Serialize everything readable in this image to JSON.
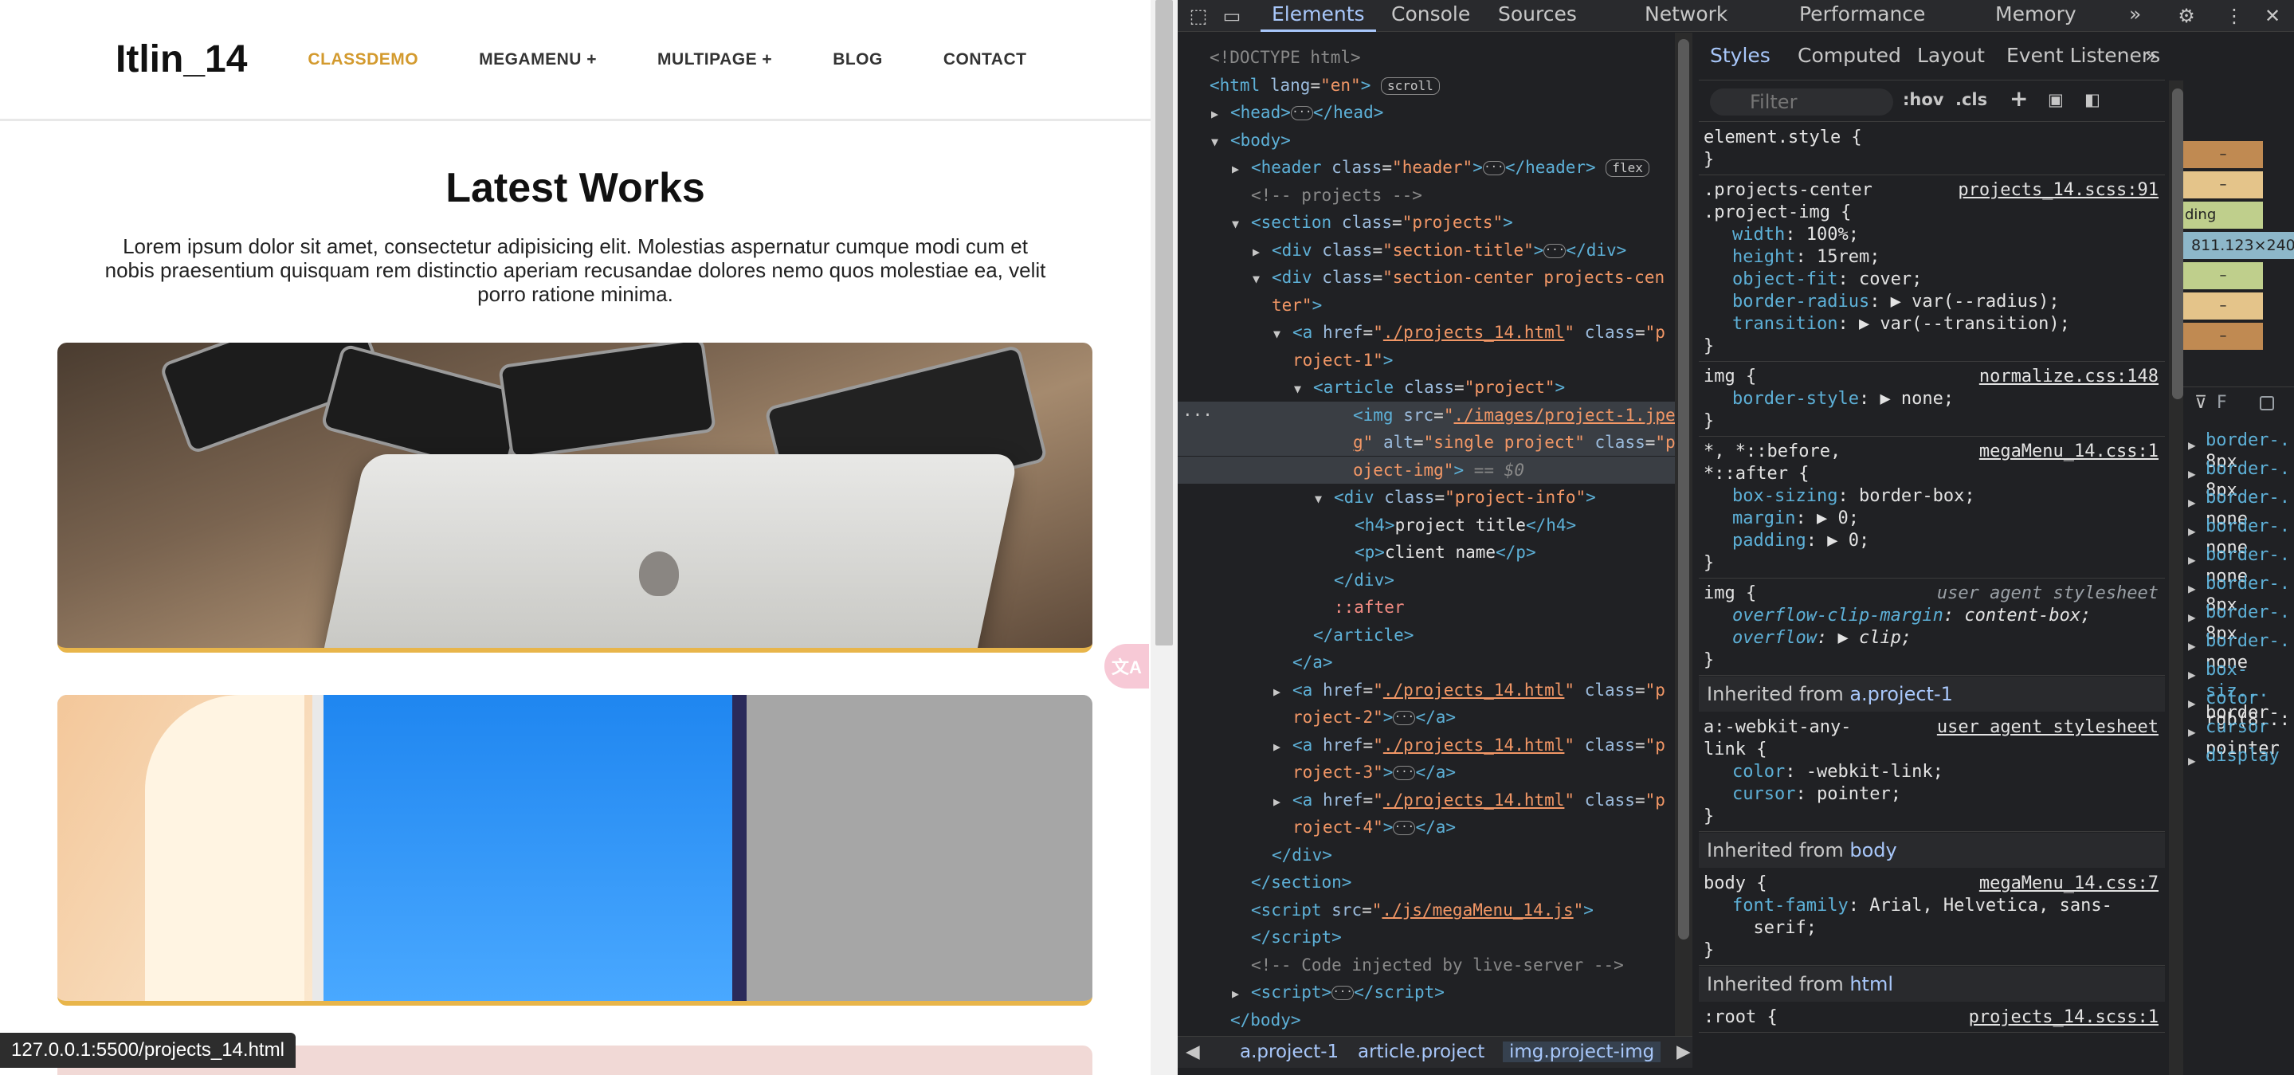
{
  "page": {
    "logo": "Itlin_14",
    "nav": [
      {
        "label": "CLASSDEMO",
        "active": true
      },
      {
        "label": "MEGAMENU +"
      },
      {
        "label": "MULTIPAGE +"
      },
      {
        "label": "BLOG"
      },
      {
        "label": "CONTACT"
      }
    ],
    "section_title": "Latest Works",
    "section_desc": "Lorem ipsum dolor sit amet, consectetur adipisicing elit. Molestias aspernatur cumque modi cum et nobis praesentium quisquam rem distinctio aperiam recusandae dolores nemo quos molestiae ea, velit porro ratione minima.",
    "status_url": "127.0.0.1:5500/projects_14.html",
    "accent": "#d39a2e",
    "card_border": "#e8b54a"
  },
  "devtools": {
    "tabs": [
      "Elements",
      "Console",
      "Sources",
      "Network",
      "Performance",
      "Memory"
    ],
    "more_tabs": "»",
    "dom": [
      {
        "indent": 0,
        "tri": "",
        "html": "<span class='cmt'>&lt;!DOCTYPE html&gt;</span>"
      },
      {
        "indent": 0,
        "tri": "",
        "html": "<span class='tag'>&lt;html</span> <span class='attr'>lang</span>=<span class='val'>\"en\"</span><span class='tag'>&gt;</span> <span class='badge'>scroll</span>"
      },
      {
        "indent": 1,
        "tri": "▶",
        "html": "<span class='tag'>&lt;head&gt;</span><span class='ellip'>···</span><span class='tag'>&lt;/head&gt;</span>"
      },
      {
        "indent": 1,
        "tri": "▼",
        "html": "<span class='tag'>&lt;body&gt;</span>"
      },
      {
        "indent": 2,
        "tri": "▶",
        "html": "<span class='tag'>&lt;header</span> <span class='attr'>class</span>=<span class='val'>\"header\"</span><span class='tag'>&gt;</span><span class='ellip'>···</span><span class='tag'>&lt;/header&gt;</span> <span class='badge'>flex</span>"
      },
      {
        "indent": 2,
        "tri": "",
        "html": "<span class='cmt'>&lt;!-- projects --&gt;</span>"
      },
      {
        "indent": 2,
        "tri": "▼",
        "html": "<span class='tag'>&lt;section</span> <span class='attr'>class</span>=<span class='val'>\"projects\"</span><span class='tag'>&gt;</span>"
      },
      {
        "indent": 3,
        "tri": "▶",
        "html": "<span class='tag'>&lt;div</span> <span class='attr'>class</span>=<span class='val'>\"section-title\"</span><span class='tag'>&gt;</span><span class='ellip'>···</span><span class='tag'>&lt;/div&gt;</span>"
      },
      {
        "indent": 3,
        "tri": "▼",
        "html": "<span class='tag'>&lt;div</span> <span class='attr'>class</span>=<span class='val'>\"section-center projects-cen</span>"
      },
      {
        "indent": 3,
        "tri": "",
        "html": "<span class='val'>ter\"</span><span class='tag'>&gt;</span>"
      },
      {
        "indent": 4,
        "tri": "▼",
        "html": "<span class='tag'>&lt;a</span> <span class='attr'>href</span>=<span class='val'>\"<span class='link'>./projects_14.html</span>\"</span> <span class='attr'>class</span>=<span class='val'>\"p</span>"
      },
      {
        "indent": 4,
        "tri": "",
        "html": "<span class='val'>roject-1\"</span><span class='tag'>&gt;</span>"
      },
      {
        "indent": 5,
        "tri": "▼",
        "html": "<span class='tag'>&lt;article</span> <span class='attr'>class</span>=<span class='val'>\"project\"</span><span class='tag'>&gt;</span>"
      },
      {
        "indent": 6,
        "tri": "",
        "selected": true,
        "html": "<span class='tag'>&lt;img</span> <span class='attr'>src</span>=<span class='val'>\"<span class='link'>./images/project-1.jpe</span></span>"
      },
      {
        "indent": 6,
        "tri": "",
        "selected": true,
        "html": "<span class='link val'>g</span><span class='val'>\"</span> <span class='attr'>alt</span>=<span class='val'>\"single project\"</span> <span class='attr'>class</span>=<span class='val'>\"pr</span>"
      },
      {
        "indent": 6,
        "tri": "",
        "selected": true,
        "html": "<span class='val'>oject-img\"</span><span class='tag'>&gt;</span> <span class='cmt'>== <i>$0</i></span>"
      },
      {
        "indent": 6,
        "tri": "▼",
        "html": "<span class='tag'>&lt;div</span> <span class='attr'>class</span>=<span class='val'>\"project-info\"</span><span class='tag'>&gt;</span>"
      },
      {
        "indent": 7,
        "tri": "",
        "html": "<span class='tag'>&lt;h4&gt;</span><span class='txt'>project title</span><span class='tag'>&lt;/h4&gt;</span>"
      },
      {
        "indent": 7,
        "tri": "",
        "html": "<span class='tag'>&lt;p&gt;</span><span class='txt'>client name</span><span class='tag'>&lt;/p&gt;</span>"
      },
      {
        "indent": 6,
        "tri": "",
        "html": "<span class='tag'>&lt;/div&gt;</span>"
      },
      {
        "indent": 6,
        "tri": "",
        "html": "<span class='pseudo'>::after</span>"
      },
      {
        "indent": 5,
        "tri": "",
        "html": "<span class='tag'>&lt;/article&gt;</span>"
      },
      {
        "indent": 4,
        "tri": "",
        "html": "<span class='tag'>&lt;/a&gt;</span>"
      },
      {
        "indent": 4,
        "tri": "▶",
        "html": "<span class='tag'>&lt;a</span> <span class='attr'>href</span>=<span class='val'>\"<span class='link'>./projects_14.html</span>\"</span> <span class='attr'>class</span>=<span class='val'>\"p</span>"
      },
      {
        "indent": 4,
        "tri": "",
        "html": "<span class='val'>roject-2\"</span><span class='tag'>&gt;</span><span class='ellip'>···</span><span class='tag'>&lt;/a&gt;</span>"
      },
      {
        "indent": 4,
        "tri": "▶",
        "html": "<span class='tag'>&lt;a</span> <span class='attr'>href</span>=<span class='val'>\"<span class='link'>./projects_14.html</span>\"</span> <span class='attr'>class</span>=<span class='val'>\"p</span>"
      },
      {
        "indent": 4,
        "tri": "",
        "html": "<span class='val'>roject-3\"</span><span class='tag'>&gt;</span><span class='ellip'>···</span><span class='tag'>&lt;/a&gt;</span>"
      },
      {
        "indent": 4,
        "tri": "▶",
        "html": "<span class='tag'>&lt;a</span> <span class='attr'>href</span>=<span class='val'>\"<span class='link'>./projects_14.html</span>\"</span> <span class='attr'>class</span>=<span class='val'>\"p</span>"
      },
      {
        "indent": 4,
        "tri": "",
        "html": "<span class='val'>roject-4\"</span><span class='tag'>&gt;</span><span class='ellip'>···</span><span class='tag'>&lt;/a&gt;</span>"
      },
      {
        "indent": 3,
        "tri": "",
        "html": "<span class='tag'>&lt;/div&gt;</span>"
      },
      {
        "indent": 2,
        "tri": "",
        "html": "<span class='tag'>&lt;/section&gt;</span>"
      },
      {
        "indent": 2,
        "tri": "",
        "html": "<span class='tag'>&lt;script</span> <span class='attr'>src</span>=<span class='val'>\"<span class='link'>./js/megaMenu_14.js</span>\"</span><span class='tag'>&gt;</span>"
      },
      {
        "indent": 2,
        "tri": "",
        "html": "<span class='tag'>&lt;/script&gt;</span>"
      },
      {
        "indent": 2,
        "tri": "",
        "html": "<span class='cmt'>&lt;!-- Code injected by live-server --&gt;</span>"
      },
      {
        "indent": 2,
        "tri": "▶",
        "html": "<span class='tag'>&lt;script&gt;</span><span class='ellip'>···</span><span class='tag'>&lt;/script&gt;</span>"
      },
      {
        "indent": 1,
        "tri": "",
        "html": "<span class='tag'>&lt;/body&gt;</span>"
      }
    ],
    "breadcrumbs": [
      "a.project-1",
      "article.project",
      "img.project-img"
    ],
    "styles_tabs": [
      "Styles",
      "Computed",
      "Layout",
      "Event Listeners"
    ],
    "styles_more": "»",
    "filter_placeholder": "Filter",
    "filter_hov": ":hov",
    "filter_cls": ".cls",
    "rules": [
      {
        "selector": "element.style {",
        "source": "",
        "props": [],
        "close": "}"
      },
      {
        "selector": ".projects-center\n.project-img {",
        "source": "projects_14.scss:91",
        "props": [
          [
            "width",
            "100%;"
          ],
          [
            "height",
            "15rem;"
          ],
          [
            "object-fit",
            "cover;"
          ],
          [
            "border-radius",
            "▶ var(--radius);"
          ],
          [
            "transition",
            "▶ var(--transition);"
          ]
        ],
        "close": "}"
      },
      {
        "selector": "img {",
        "source": "normalize.css:148",
        "props": [
          [
            "border-style",
            "▶ none;"
          ]
        ],
        "close": "}"
      },
      {
        "selector": "*, *::before,\n*::after {",
        "source": "megaMenu_14.css:1",
        "props": [
          [
            "box-sizing",
            "border-box;"
          ],
          [
            "margin",
            "▶ 0;"
          ],
          [
            "padding",
            "▶ 0;"
          ]
        ],
        "close": "}"
      },
      {
        "selector": "img {",
        "source": "user agent stylesheet",
        "ua": true,
        "props": [
          [
            "overflow-clip-margin",
            "content-box;"
          ],
          [
            "overflow",
            "▶ clip;"
          ]
        ],
        "close": "}"
      }
    ],
    "inherited_1_label": "Inherited from",
    "inherited_1_target": "a.project-1",
    "rule_a": {
      "selector": "a:-webkit-any-\nlink {",
      "source": "user agent stylesheet",
      "props": [
        [
          "color",
          "-webkit-link;"
        ],
        [
          "cursor",
          "pointer;"
        ]
      ],
      "close": "}"
    },
    "inherited_2_label": "Inherited from",
    "inherited_2_target": "body",
    "rule_body": {
      "selector": "body {",
      "source": "megaMenu_14.css:7",
      "props": [
        [
          "font-family",
          "Arial, Helvetica, sans-\n  serif;"
        ]
      ],
      "close": "}"
    },
    "inherited_3_label": "Inherited from",
    "inherited_3_target": "html",
    "rule_root": {
      "selector": ":root {",
      "source": "projects_14.scss:1"
    },
    "box_model": {
      "dims": "811.123×240",
      "side_label": "ding",
      "dashes": [
        "–",
        "–",
        "–",
        "–",
        "–",
        "–"
      ]
    },
    "computed": [
      {
        "name": "border-...",
        "value": "8px"
      },
      {
        "name": "border-...",
        "value": "8px"
      },
      {
        "name": "border-...",
        "value": "none"
      },
      {
        "name": "border-...",
        "value": "none"
      },
      {
        "name": "border-...",
        "value": "none"
      },
      {
        "name": "border-...",
        "value": "8px"
      },
      {
        "name": "border-...",
        "value": "8px"
      },
      {
        "name": "border-...",
        "value": "none"
      },
      {
        "name": "box-siz...",
        "value": "border-..."
      },
      {
        "name": "color",
        "value": "rgb(8..."
      },
      {
        "name": "cursor",
        "value": "pointer"
      },
      {
        "name": "display",
        "value": ""
      }
    ],
    "computed_filter": "F"
  }
}
